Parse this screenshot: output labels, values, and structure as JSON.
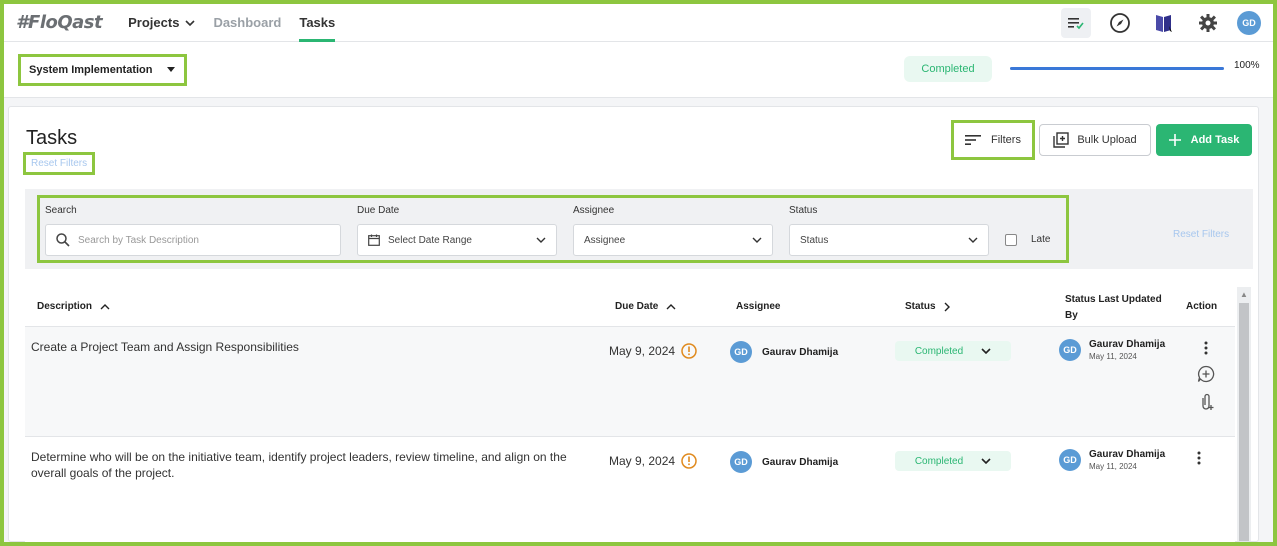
{
  "nav": {
    "logo": "#FloQast",
    "items": [
      {
        "label": "Projects"
      },
      {
        "label": "Dashboard"
      },
      {
        "label": "Tasks"
      }
    ],
    "avatar": "GD"
  },
  "subheader": {
    "project": "System Implementation",
    "status": "Completed",
    "progress_percent": 100,
    "progress_label": "100%"
  },
  "panel": {
    "title": "Tasks",
    "reset_filters": "Reset Filters",
    "filters_label": "Filters",
    "bulk_upload_label": "Bulk Upload",
    "add_task_label": "Add Task"
  },
  "filters": {
    "search_label": "Search",
    "search_placeholder": "Search by Task Description",
    "due_date_label": "Due Date",
    "due_date_value": "Select Date Range",
    "assignee_label": "Assignee",
    "assignee_value": "Assignee",
    "status_label": "Status",
    "status_value": "Status",
    "late_label": "Late",
    "reset_filters": "Reset Filters"
  },
  "table": {
    "columns": {
      "description": "Description",
      "due_date": "Due Date",
      "assignee": "Assignee",
      "status": "Status",
      "status_last_updated": "Status Last Updated By",
      "action": "Action"
    },
    "rows": [
      {
        "description": "Create a Project Team and Assign Responsibilities",
        "due_date": "May 9, 2024",
        "assignee_initials": "GD",
        "assignee": "Gaurav Dhamija",
        "status": "Completed",
        "updated_initials": "GD",
        "updated_by": "Gaurav Dhamija",
        "updated_date": "May 11, 2024"
      },
      {
        "description": "Determine who will be on the initiative team, identify project leaders, review timeline, and align on the overall goals of the project.",
        "due_date": "May 9, 2024",
        "assignee_initials": "GD",
        "assignee": "Gaurav Dhamija",
        "status": "Completed",
        "updated_initials": "GD",
        "updated_by": "Gaurav Dhamija",
        "updated_date": "May 11, 2024"
      }
    ]
  },
  "colors": {
    "accent": "#2bb673",
    "highlight": "#8dc63f",
    "progress": "#3a78d8",
    "warning": "#e08a1e"
  }
}
